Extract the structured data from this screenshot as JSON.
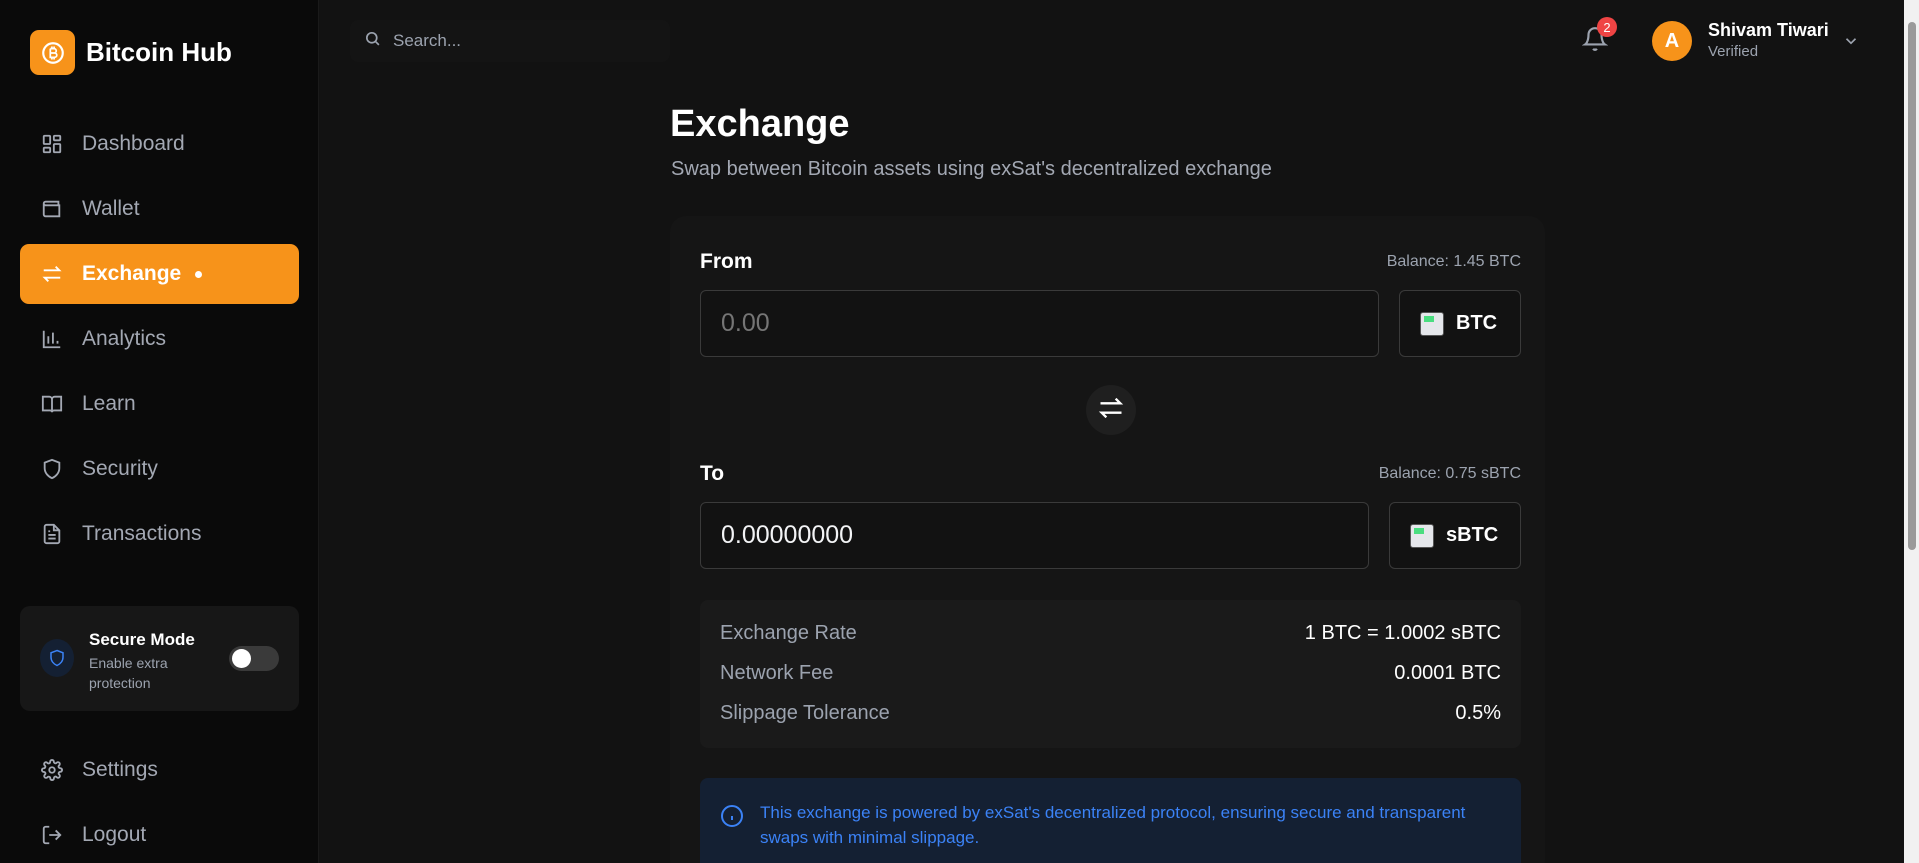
{
  "brand": {
    "name": "Bitcoin Hub",
    "logo_icon": "bitcoin-icon",
    "accent": "#f7931a"
  },
  "sidebar": {
    "items": [
      {
        "label": "Dashboard",
        "icon": "dashboard-icon"
      },
      {
        "label": "Wallet",
        "icon": "wallet-icon"
      },
      {
        "label": "Exchange",
        "icon": "exchange-icon",
        "active": true
      },
      {
        "label": "Analytics",
        "icon": "bar-chart-icon"
      },
      {
        "label": "Learn",
        "icon": "book-icon"
      },
      {
        "label": "Security",
        "icon": "shield-icon"
      },
      {
        "label": "Transactions",
        "icon": "document-icon"
      }
    ],
    "secure_mode": {
      "title": "Secure Mode",
      "description": "Enable extra protection",
      "enabled": false
    },
    "bottom": [
      {
        "label": "Settings",
        "icon": "gear-icon"
      },
      {
        "label": "Logout",
        "icon": "logout-icon"
      }
    ]
  },
  "topbar": {
    "search_placeholder": "Search...",
    "notifications_count": "2",
    "user": {
      "initial": "A",
      "name": "Shivam Tiwari",
      "status": "Verified"
    }
  },
  "main": {
    "title": "Exchange",
    "subtitle": "Swap between Bitcoin assets using exSat's decentralized exchange",
    "from": {
      "label": "From",
      "balance": "Balance: 1.45 BTC",
      "placeholder": "0.00",
      "token": "BTC"
    },
    "to": {
      "label": "To",
      "balance": "Balance: 0.75 sBTC",
      "value": "0.00000000",
      "token": "sBTC"
    },
    "details": [
      {
        "key": "Exchange Rate",
        "value": "1 BTC = 1.0002 sBTC"
      },
      {
        "key": "Network Fee",
        "value": "0.0001 BTC"
      },
      {
        "key": "Slippage Tolerance",
        "value": "0.5%"
      }
    ],
    "info": "This exchange is powered by exSat's decentralized protocol, ensuring secure and transparent swaps with minimal slippage."
  }
}
